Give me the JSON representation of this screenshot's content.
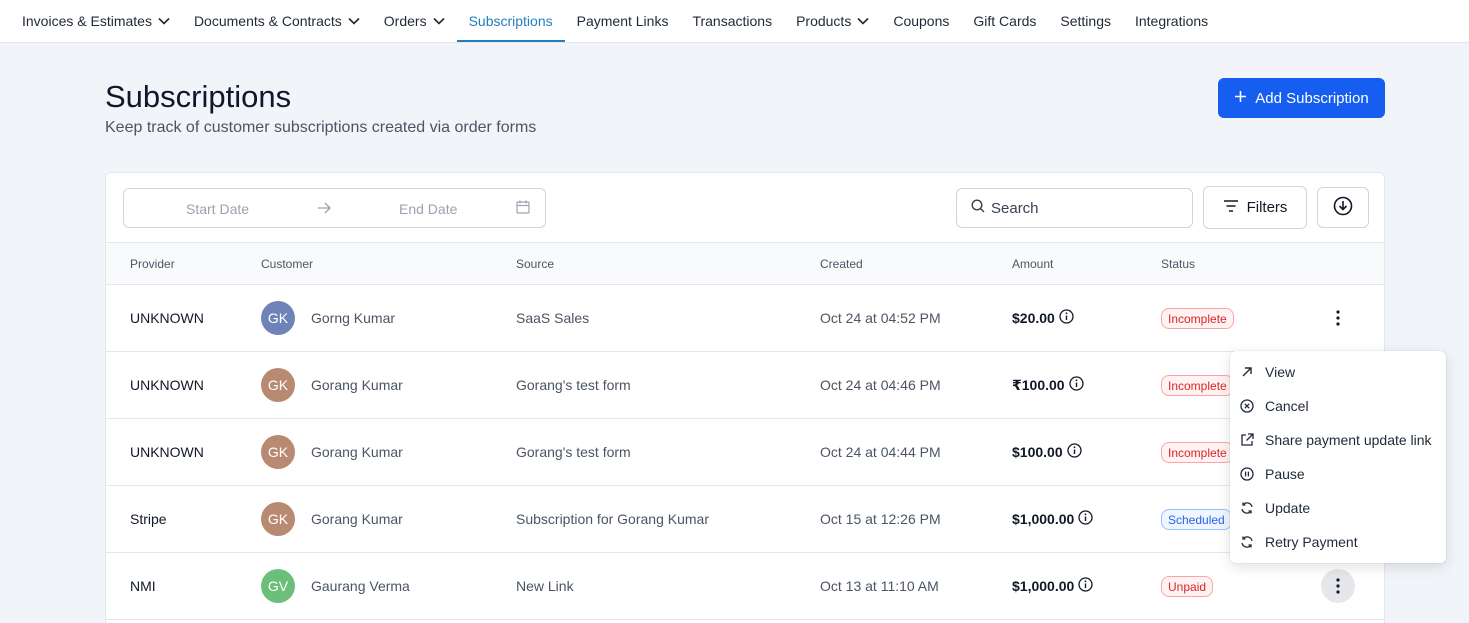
{
  "nav": {
    "items": [
      {
        "label": "Invoices & Estimates",
        "dropdown": true
      },
      {
        "label": "Documents & Contracts",
        "dropdown": true
      },
      {
        "label": "Orders",
        "dropdown": true
      },
      {
        "label": "Subscriptions",
        "dropdown": false,
        "active": true
      },
      {
        "label": "Payment Links",
        "dropdown": false
      },
      {
        "label": "Transactions",
        "dropdown": false
      },
      {
        "label": "Products",
        "dropdown": true
      },
      {
        "label": "Coupons",
        "dropdown": false
      },
      {
        "label": "Gift Cards",
        "dropdown": false
      },
      {
        "label": "Settings",
        "dropdown": false
      },
      {
        "label": "Integrations",
        "dropdown": false
      }
    ]
  },
  "header": {
    "title": "Subscriptions",
    "subtitle": "Keep track of customer subscriptions created via order forms",
    "add_button": "Add Subscription"
  },
  "toolbar": {
    "start_date_placeholder": "Start Date",
    "end_date_placeholder": "End Date",
    "search_placeholder": "Search",
    "filters_label": "Filters"
  },
  "table": {
    "columns": [
      "Provider",
      "Customer",
      "Source",
      "Created",
      "Amount",
      "Status"
    ],
    "rows": [
      {
        "provider": "UNKNOWN",
        "initials": "GK",
        "avatar_color": "#7083b8",
        "customer": "Gorng Kumar",
        "source": "SaaS Sales",
        "created": "Oct 24 at 04:52 PM",
        "amount": "$20.00",
        "status": "Incomplete",
        "status_color": "red"
      },
      {
        "provider": "UNKNOWN",
        "initials": "GK",
        "avatar_color": "#b98a72",
        "customer": "Gorang Kumar",
        "source": "Gorang's test form",
        "created": "Oct 24 at 04:46 PM",
        "amount": "₹100.00",
        "status": "Incomplete",
        "status_color": "red"
      },
      {
        "provider": "UNKNOWN",
        "initials": "GK",
        "avatar_color": "#b98a72",
        "customer": "Gorang Kumar",
        "source": "Gorang's test form",
        "created": "Oct 24 at 04:44 PM",
        "amount": "$100.00",
        "status": "Incomplete",
        "status_color": "red"
      },
      {
        "provider": "Stripe",
        "initials": "GK",
        "avatar_color": "#b98a72",
        "customer": "Gorang Kumar",
        "source": "Subscription for Gorang Kumar",
        "created": "Oct 15 at 12:26 PM",
        "amount": "$1,000.00",
        "status": "Scheduled",
        "status_color": "blue"
      },
      {
        "provider": "NMI",
        "initials": "GV",
        "avatar_color": "#6cbf7a",
        "customer": "Gaurang Verma",
        "source": "New Link",
        "created": "Oct 13 at 11:10 AM",
        "amount": "$1,000.00",
        "status": "Unpaid",
        "status_color": "red"
      }
    ]
  },
  "row_menu": {
    "items": [
      {
        "label": "View",
        "icon": "arrow-up-right-icon"
      },
      {
        "label": "Cancel",
        "icon": "x-circle-icon"
      },
      {
        "label": "Share payment update link",
        "icon": "external-link-icon"
      },
      {
        "label": "Pause",
        "icon": "pause-circle-icon"
      },
      {
        "label": "Update",
        "icon": "refresh-icon"
      },
      {
        "label": "Retry Payment",
        "icon": "refresh-icon"
      }
    ]
  },
  "colors": {
    "accent": "#155eef",
    "active_tab": "#1f7fbf",
    "badge_red": "#dc2626",
    "badge_blue": "#2563eb"
  }
}
